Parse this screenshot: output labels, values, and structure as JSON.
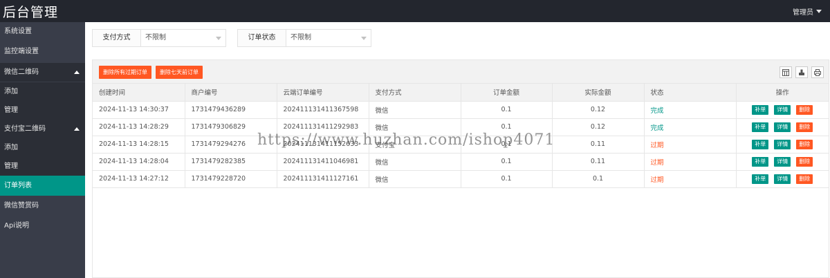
{
  "header": {
    "title": "后台管理",
    "user": "管理员"
  },
  "sidebar": {
    "items": [
      {
        "label": "系统设置"
      },
      {
        "label": "监控端设置"
      },
      {
        "label": "微信二维码"
      },
      {
        "label": "添加"
      },
      {
        "label": "管理"
      },
      {
        "label": "支付宝二维码"
      },
      {
        "label": "添加"
      },
      {
        "label": "管理"
      },
      {
        "label": "订单列表"
      },
      {
        "label": "微信赞赏码"
      },
      {
        "label": "Api说明"
      }
    ]
  },
  "filters": {
    "pay_method": {
      "label": "支付方式",
      "value": "不限制"
    },
    "order_status": {
      "label": "订单状态",
      "value": "不限制"
    }
  },
  "toolbar": {
    "delete_expired": "删除所有过期订单",
    "delete_7days": "删除七天前订单",
    "icons": [
      "columns-icon",
      "export-icon",
      "print-icon"
    ]
  },
  "table": {
    "headers": [
      "创建时间",
      "商户编号",
      "云端订单编号",
      "支付方式",
      "订单金额",
      "实际金额",
      "状态",
      "操作"
    ],
    "rows": [
      {
        "time": "2024-11-13 14:30:37",
        "merchant": "1731479436289",
        "cloud": "202411131411367598",
        "method": "微信",
        "amount": "0.1",
        "actual": "0.12",
        "status": "完成"
      },
      {
        "time": "2024-11-13 14:28:29",
        "merchant": "1731479306829",
        "cloud": "202411131411292983",
        "method": "微信",
        "amount": "0.1",
        "actual": "0.12",
        "status": "完成"
      },
      {
        "time": "2024-11-13 14:28:15",
        "merchant": "1731479294276",
        "cloud": "202411131411152633",
        "method": "支付宝",
        "amount": "0.1",
        "actual": "0.11",
        "status": "过期"
      },
      {
        "time": "2024-11-13 14:28:04",
        "merchant": "1731479282385",
        "cloud": "202411131411046981",
        "method": "微信",
        "amount": "0.1",
        "actual": "0.11",
        "status": "过期"
      },
      {
        "time": "2024-11-13 14:27:12",
        "merchant": "1731479228720",
        "cloud": "202411131411127161",
        "method": "微信",
        "amount": "0.1",
        "actual": "0.1",
        "status": "过期"
      }
    ],
    "ops": {
      "reissue": "补单",
      "detail": "详情",
      "delete": "删除"
    }
  },
  "watermark": "https://www.huzhan.com/ishop4071",
  "colors": {
    "header": "#23262e",
    "sidebar": "#393d49",
    "active": "#009688",
    "danger": "#ff5722"
  }
}
